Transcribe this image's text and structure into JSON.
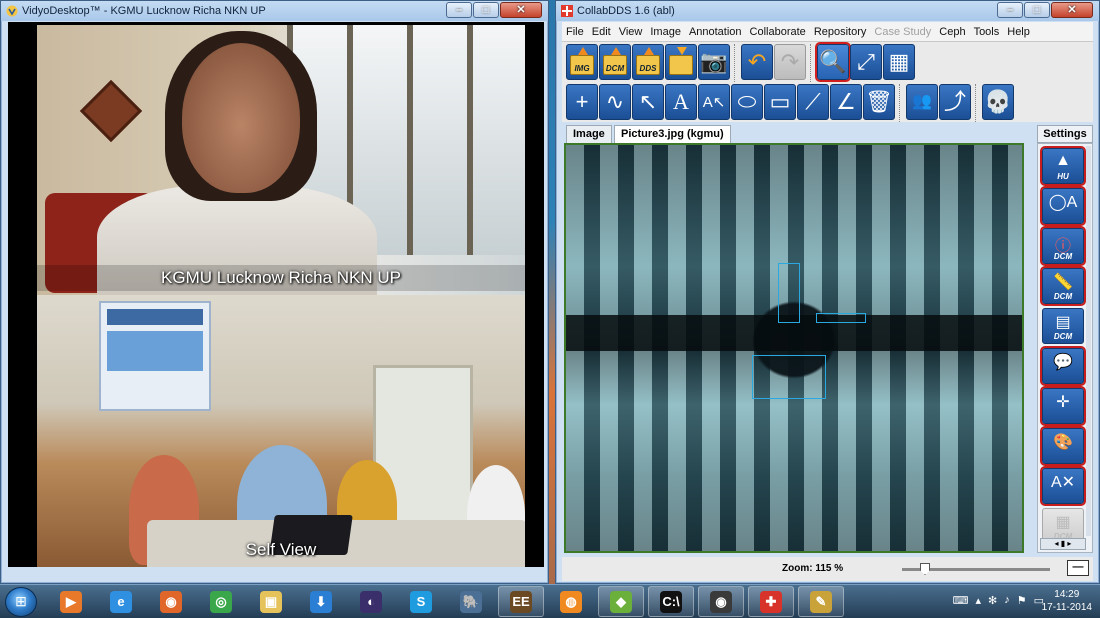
{
  "vidyo": {
    "title": "VidyoDesktop™ - KGMU Lucknow Richa NKN UP",
    "remote_caption": "KGMU Lucknow Richa NKN UP",
    "self_caption": "Self View"
  },
  "collab": {
    "title": "CollabDDS 1.6 (abl)",
    "menu": [
      "File",
      "Edit",
      "View",
      "Image",
      "Annotation",
      "Collaborate",
      "Repository",
      "Case Study",
      "Ceph",
      "Tools",
      "Help"
    ],
    "menu_disabled": [
      "Case Study"
    ],
    "toolbar": {
      "load_labels": [
        "IMG",
        "DCM",
        "DDS"
      ],
      "row1_icons": [
        "open-img-icon",
        "open-dcm-icon",
        "open-dds-icon",
        "save-folder-icon",
        "camera-icon",
        "undo-icon",
        "redo-icon",
        "zoom-icon",
        "fit-screen-icon",
        "grid-icon"
      ],
      "row2_icons": [
        "crosshair-icon",
        "freehand-icon",
        "arrow-icon",
        "text-icon",
        "text-arrow-icon",
        "ellipse-icon",
        "rectangle-icon",
        "line-measure-icon",
        "angle-icon",
        "trash-icon",
        "user-lock-icon",
        "share-icon",
        "skull-icon"
      ]
    },
    "tabs": [
      "Image",
      "Picture3.jpg (kgmu)"
    ],
    "settings_tab": "Settings",
    "settings_buttons": [
      {
        "icon": "hu-histogram-icon",
        "label": "HU"
      },
      {
        "icon": "shape-text-icon",
        "label": ""
      },
      {
        "icon": "info-icon",
        "label": "DCM"
      },
      {
        "icon": "ruler-icon",
        "label": "DCM"
      },
      {
        "icon": "dicom-viewer-icon",
        "label": "DCM"
      },
      {
        "icon": "comment-user-icon",
        "label": ""
      },
      {
        "icon": "axes-icon",
        "label": ""
      },
      {
        "icon": "color-palette-icon",
        "label": ""
      },
      {
        "icon": "text-tools-icon",
        "label": ""
      },
      {
        "icon": "dicom-disabled-icon",
        "label": "DCM"
      }
    ],
    "zoom_label": "Zoom: 115 %",
    "zoom_value": 0.13
  },
  "taskbar": {
    "apps": [
      "media-player",
      "internet-explorer",
      "firefox",
      "chrome",
      "file-explorer",
      "downloader",
      "eclipse",
      "skype",
      "postgres",
      "java-ee",
      "vpn",
      "photos",
      "command-prompt",
      "camera",
      "collabdds",
      "paint"
    ],
    "open_apps": [
      "java-ee",
      "photos",
      "command-prompt",
      "camera",
      "collabdds",
      "paint"
    ],
    "time": "14:29",
    "date": "17-11-2014"
  }
}
